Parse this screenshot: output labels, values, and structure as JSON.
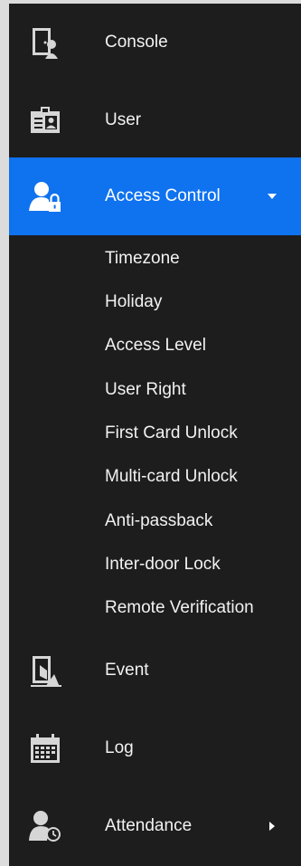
{
  "menu": {
    "console": {
      "label": "Console",
      "icon": "door-person-icon"
    },
    "user": {
      "label": "User",
      "icon": "id-card-icon"
    },
    "access_control": {
      "label": "Access Control",
      "icon": "person-lock-icon",
      "expanded": true,
      "submenu": [
        "Timezone",
        "Holiday",
        "Access Level",
        "User Right",
        "First Card Unlock",
        "Multi-card Unlock",
        "Anti-passback",
        "Inter-door Lock",
        "Remote Verification"
      ]
    },
    "event": {
      "label": "Event",
      "icon": "door-event-icon"
    },
    "log": {
      "label": "Log",
      "icon": "calendar-icon"
    },
    "attendance": {
      "label": "Attendance",
      "icon": "person-clock-icon"
    }
  },
  "colors": {
    "sidebar_bg": "#1d1d1d",
    "active_bg": "#0f72ef",
    "text": "#f2f2f2",
    "icon": "#d6d6d6"
  }
}
